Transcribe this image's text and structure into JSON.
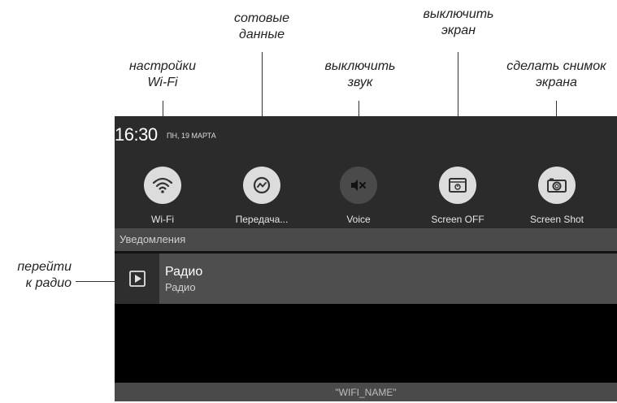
{
  "callouts": {
    "wifi_settings": [
      "настройки",
      "Wi-Fi"
    ],
    "cellular_data": [
      "сотовые",
      "данные"
    ],
    "mute": [
      "выключить",
      "звук"
    ],
    "screen_off": [
      "выключить",
      "экран"
    ],
    "screenshot": [
      "сделать снимок",
      "экрана"
    ],
    "radio": [
      "перейти",
      "к радио"
    ]
  },
  "status_bar": {
    "time": "16:30",
    "date": "ПН, 19 МАРТА"
  },
  "quick_settings": [
    {
      "label": "Wi-Fi",
      "icon": "wifi-icon"
    },
    {
      "label": "Передача...",
      "icon": "cellular-data-icon"
    },
    {
      "label": "Voice",
      "icon": "mute-icon"
    },
    {
      "label": "Screen OFF",
      "icon": "screen-off-icon"
    },
    {
      "label": "Screen Shot",
      "icon": "camera-icon"
    }
  ],
  "notifications": {
    "header": "Уведомления",
    "items": [
      {
        "title": "Радио",
        "subtitle": "Радио",
        "icon": "play-icon"
      }
    ]
  },
  "network": {
    "ssid": "\"WIFI_NAME\""
  },
  "colors": {
    "panel_bg": "#2b2b2b",
    "header_bg": "#4a4a4a",
    "button_light": "#dcdcdc",
    "button_dark": "#4a4a4a"
  }
}
